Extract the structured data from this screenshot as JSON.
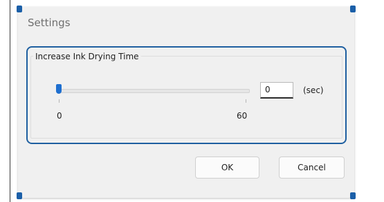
{
  "dialog": {
    "title": "Settings"
  },
  "ink_drying": {
    "group_label": "Increase Ink Drying Time",
    "slider": {
      "min_label": "0",
      "max_label": "60",
      "value": 0
    },
    "input": {
      "value": "0"
    },
    "unit_label": "(sec)"
  },
  "buttons": {
    "ok_label": "OK",
    "cancel_label": "Cancel"
  },
  "colors": {
    "accent": "#1e5fa0",
    "slider_thumb": "#1e6fd0",
    "dialog_background": "#f0f0f0"
  }
}
